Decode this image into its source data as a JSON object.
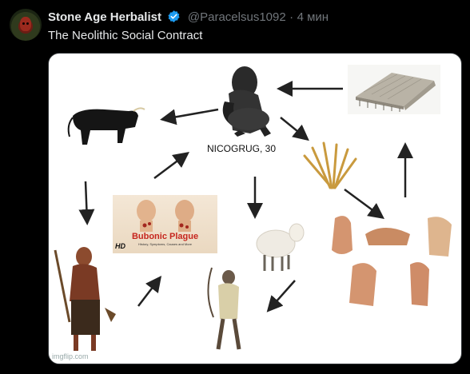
{
  "tweet": {
    "author_name": "Stone Age Herbalist",
    "handle": "@Paracelsus1092",
    "separator": "·",
    "time": "4 мин",
    "text": "The Neolithic Social Contract"
  },
  "media": {
    "center_label": "NICOGRUG, 30",
    "plague_title": "Bubonic Plague",
    "plague_subtitle": "History, Symptoms, Causes and More",
    "plague_badge": "HD",
    "watermark": "imgflip.com"
  },
  "colors": {
    "background": "#000000",
    "verified": "#1d9bf0",
    "secondary_text": "#71767b"
  }
}
